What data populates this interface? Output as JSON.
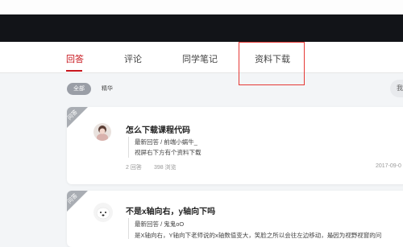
{
  "nav": {
    "tabs": [
      {
        "label": "回答",
        "active": true
      },
      {
        "label": "评论",
        "active": false
      },
      {
        "label": "同学笔记",
        "active": false
      },
      {
        "label": "资料下载",
        "active": false
      }
    ]
  },
  "filters": {
    "all": "全部",
    "essence": "精华",
    "search_stub": "我"
  },
  "questions": [
    {
      "badge": "问答",
      "title": "怎么下载课程代码",
      "answer_meta": "最新回答 / 前端小蜗牛_",
      "answer_text": "视屏右下方有个资料下载",
      "answers_count": "2 回答",
      "views": "398 浏览",
      "date": "2017-09-0"
    },
    {
      "badge": "问答",
      "title": "不是x轴向右，y轴向下吗",
      "answer_meta": "最新回答 / 鬼鬼oO",
      "answer_text": "是X轴向右，Y轴向下老师说的x轴数值变大，笑脸之所以会往左边移动，是因为视野视窗的问"
    }
  ]
}
